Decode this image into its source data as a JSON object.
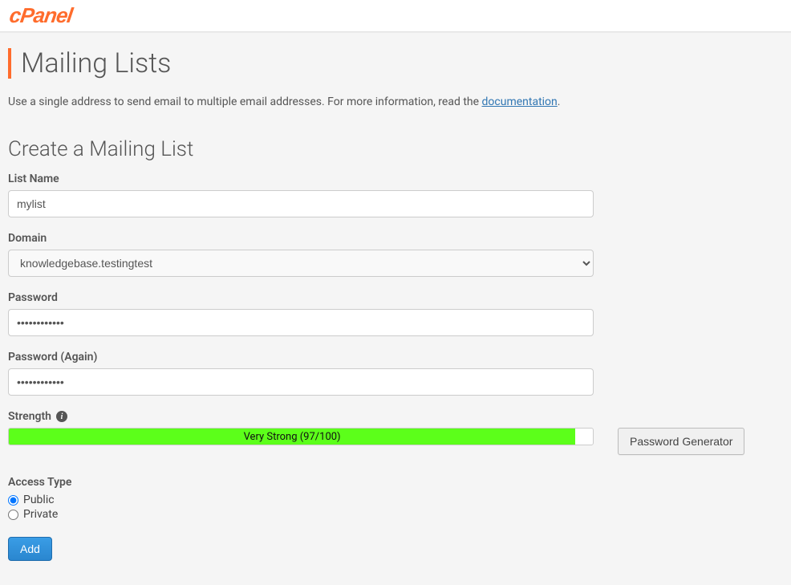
{
  "header": {
    "logo_text": "cPanel"
  },
  "page": {
    "title": "Mailing Lists",
    "intro_prefix": "Use a single address to send email to multiple email addresses. For more information, read the ",
    "intro_link": "documentation",
    "intro_suffix": "."
  },
  "form": {
    "section_heading": "Create a Mailing List",
    "list_name_label": "List Name",
    "list_name_value": "mylist",
    "domain_label": "Domain",
    "domain_value": "knowledgebase.testingtest",
    "password_label": "Password",
    "password_value": "••••••••••••",
    "password_again_label": "Password (Again)",
    "password_again_value": "••••••••••••",
    "strength_label": "Strength",
    "strength_text": "Very Strong (97/100)",
    "strength_percent": "97",
    "pw_generator_label": "Password Generator",
    "access_type_label": "Access Type",
    "access_public": "Public",
    "access_private": "Private",
    "add_label": "Add"
  }
}
